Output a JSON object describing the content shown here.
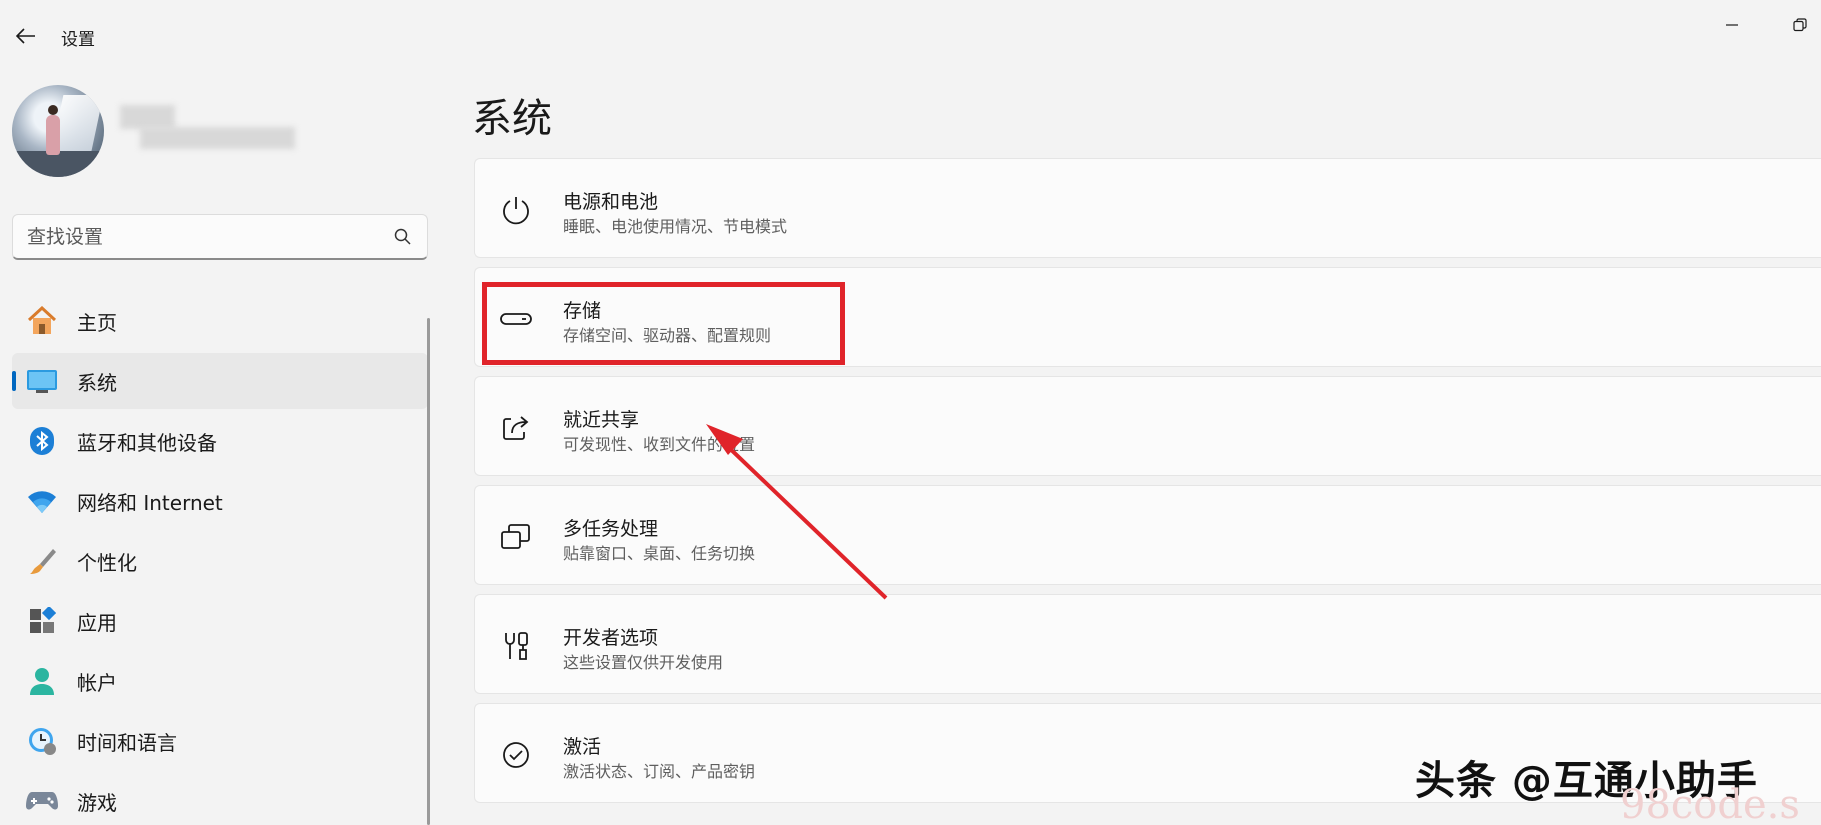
{
  "titlebar": {
    "app_title": "设置"
  },
  "search": {
    "placeholder": "查找设置"
  },
  "sidebar": {
    "items": [
      {
        "label": "主页",
        "icon": "home-icon"
      },
      {
        "label": "系统",
        "icon": "monitor-icon",
        "active": true
      },
      {
        "label": "蓝牙和其他设备",
        "icon": "bluetooth-icon"
      },
      {
        "label": "网络和 Internet",
        "icon": "wifi-icon"
      },
      {
        "label": "个性化",
        "icon": "brush-icon"
      },
      {
        "label": "应用",
        "icon": "apps-icon"
      },
      {
        "label": "帐户",
        "icon": "account-icon"
      },
      {
        "label": "时间和语言",
        "icon": "clock-globe-icon"
      },
      {
        "label": "游戏",
        "icon": "gamepad-icon"
      }
    ]
  },
  "main": {
    "title": "系统",
    "cards": [
      {
        "title": "电源和电池",
        "subtitle": "睡眠、电池使用情况、节电模式",
        "icon": "power-icon"
      },
      {
        "title": "存储",
        "subtitle": "存储空间、驱动器、配置规则",
        "icon": "storage-drive-icon"
      },
      {
        "title": "就近共享",
        "subtitle": "可发现性、收到文件的位置",
        "icon": "share-icon"
      },
      {
        "title": "多任务处理",
        "subtitle": "贴靠窗口、桌面、任务切换",
        "icon": "multitask-icon"
      },
      {
        "title": "开发者选项",
        "subtitle": "这些设置仅供开发使用",
        "icon": "developer-tools-icon"
      },
      {
        "title": "激活",
        "subtitle": "激活状态、订阅、产品密钥",
        "icon": "check-circle-icon"
      }
    ]
  },
  "watermark": {
    "text": "头条 @互通小助手",
    "text2": "98code.s"
  },
  "colors": {
    "accent": "#0067c0",
    "highlight": "#e0242a"
  }
}
